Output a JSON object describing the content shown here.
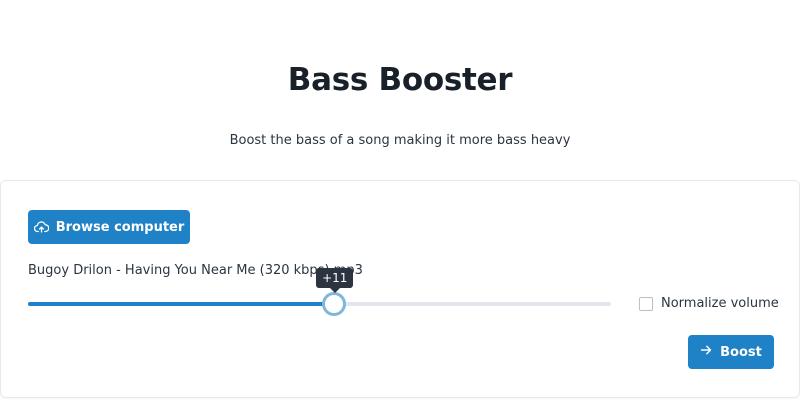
{
  "header": {
    "title": "Bass Booster",
    "subtitle": "Boost the bass of a song making it more bass heavy"
  },
  "upload": {
    "browse_label": "Browse computer",
    "browse_icon": "cloud-upload-icon",
    "file_name": "Bugoy Drilon - Having You Near Me (320 kbps).mp3"
  },
  "bass_slider": {
    "value_label": "+11",
    "fill_fraction": 0.525
  },
  "normalize": {
    "label": "Normalize volume",
    "checked": false
  },
  "actions": {
    "boost_label": "Boost",
    "boost_icon": "arrow-right-icon"
  },
  "colors": {
    "accent": "#1f81c6",
    "title": "#18202a",
    "tooltip_bg": "#2b3440"
  }
}
